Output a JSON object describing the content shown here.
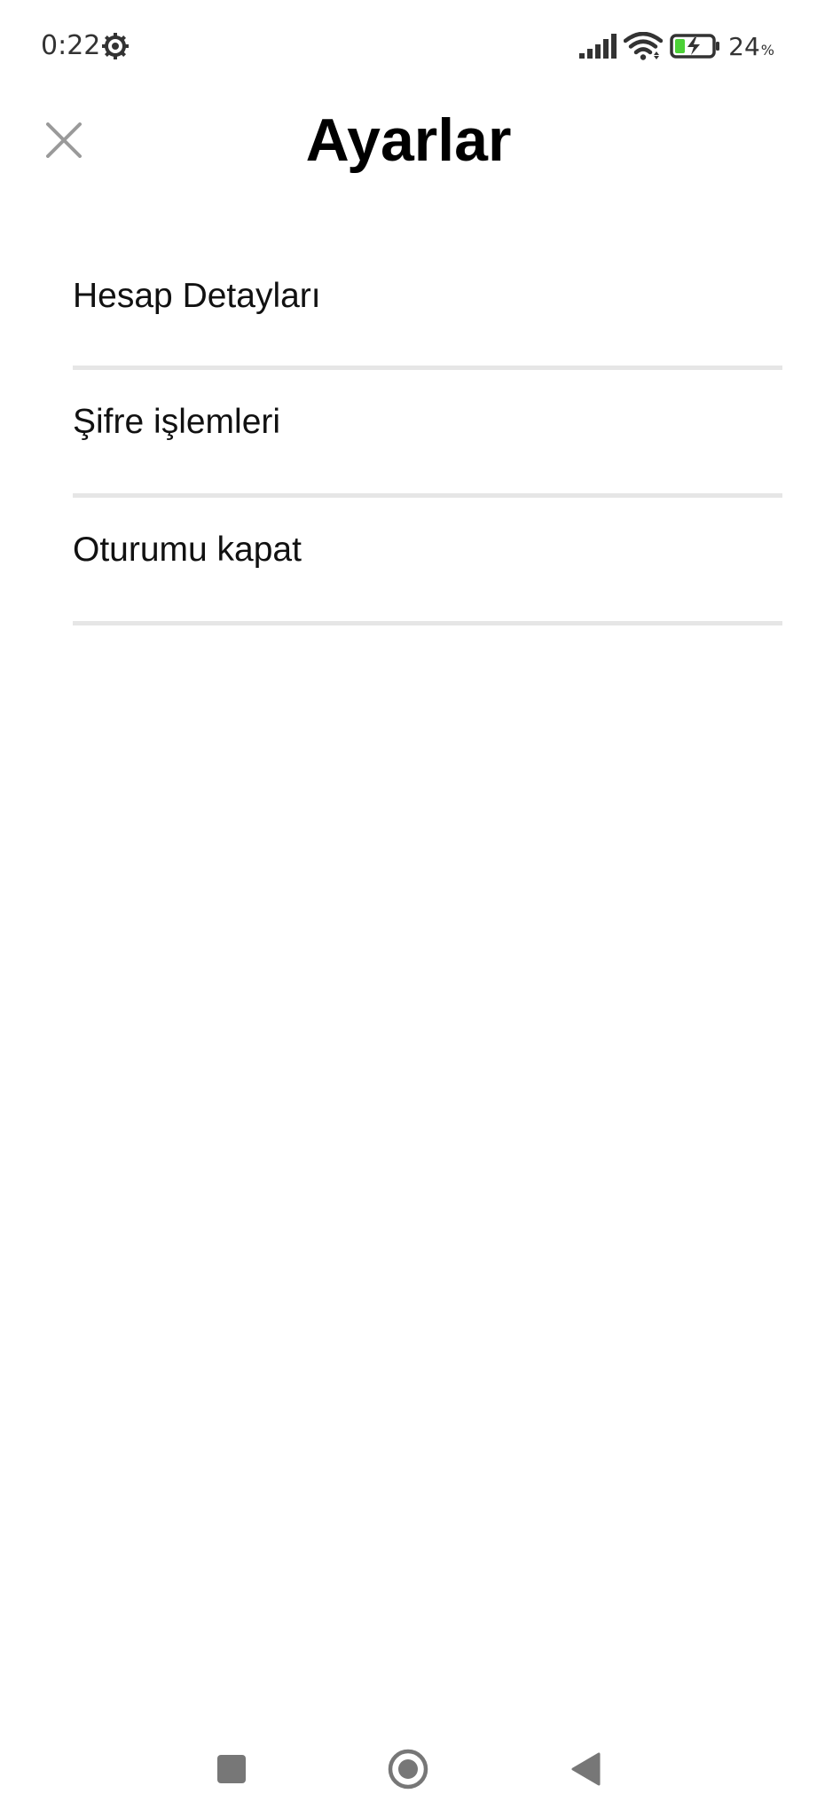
{
  "status_bar": {
    "time": "0:22",
    "battery_level": "24",
    "battery_unit": "%",
    "icons": [
      "settings-gear-icon",
      "signal-icon",
      "wifi-icon",
      "battery-charging-icon"
    ]
  },
  "header": {
    "title": "Ayarlar",
    "close_icon": "close-icon"
  },
  "settings": {
    "items": [
      {
        "label": "Hesap Detayları"
      },
      {
        "label": "Şifre işlemleri"
      },
      {
        "label": "Oturumu kapat"
      }
    ]
  },
  "nav_bar": {
    "icons": [
      "recents-square-icon",
      "home-circle-icon",
      "back-triangle-icon"
    ]
  },
  "colors": {
    "background": "#ffffff",
    "divider": "#e6e6e6",
    "icon_gray": "#777777",
    "battery_green": "#4cd137"
  }
}
